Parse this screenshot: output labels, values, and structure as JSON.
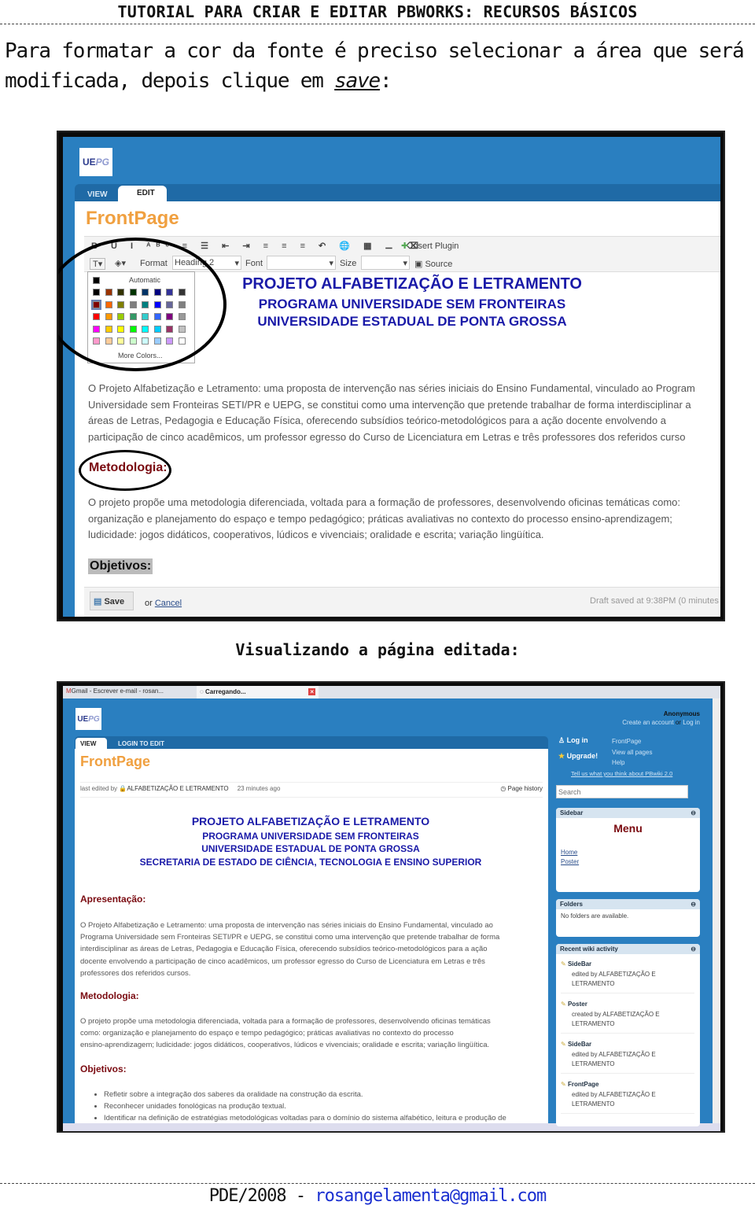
{
  "header": {
    "title": "TUTORIAL PARA CRIAR E EDITAR PBWORKS: RECURSOS BÁSICOS"
  },
  "intro": {
    "line1": "Para formatar a cor da fonte é preciso selecionar a área que será",
    "line2_prefix": "modificada, depois clique em ",
    "line2_link": "save",
    "line2_suffix": ":"
  },
  "shot1": {
    "logo_a": "UE",
    "logo_b": "PG",
    "tabs": [
      "VIEW",
      "EDIT"
    ],
    "page_title": "FrontPage",
    "toolbar": {
      "insert_plugin": "Insert Plugin",
      "format_label": "Format",
      "format_value": "Heading 2",
      "font_label": "Font",
      "size_label": "Size",
      "source": "Source"
    },
    "palette": {
      "automatic": "Automatic",
      "more": "More Colors...",
      "colors": [
        "#000000",
        "#993300",
        "#333300",
        "#003300",
        "#003366",
        "#000080",
        "#333399",
        "#333333",
        "#800000",
        "#ff6600",
        "#808000",
        "#808080",
        "#008080",
        "#0000ff",
        "#666699",
        "#808080",
        "#ff0000",
        "#ff9900",
        "#99cc00",
        "#339966",
        "#33cccc",
        "#3366ff",
        "#800080",
        "#999999",
        "#ff00ff",
        "#ffcc00",
        "#ffff00",
        "#00ff00",
        "#00ffff",
        "#00ccff",
        "#993366",
        "#c0c0c0",
        "#ff99cc",
        "#ffcc99",
        "#ffff99",
        "#ccffcc",
        "#ccffff",
        "#99ccff",
        "#cc99ff",
        "#ffffff"
      ]
    },
    "headings": [
      "PROJETO ALFABETIZAÇÃO E LETRAMENTO",
      "PROGRAMA UNIVERSIDADE SEM FRONTEIRAS",
      "UNIVERSIDADE ESTADUAL DE PONTA GROSSA"
    ],
    "para1": [
      "O Projeto Alfabetização e Letramento: uma proposta de intervenção nas séries iniciais do Ensino Fundamental, vinculado ao Program",
      "Universidade sem Fronteiras SETI/PR e UEPG, se constitui como uma intervenção que pretende trabalhar de forma interdisciplinar a",
      "áreas de Letras, Pedagogia e Educação Física, oferecendo subsídios teórico-metodológicos para a ação docente envolvendo a",
      "participação de cinco acadêmicos, um professor egresso do Curso de Licenciatura em Letras e três professores dos referidos curso"
    ],
    "metodologia": "Metodologia:",
    "para2": [
      "O projeto propõe uma metodologia diferenciada, voltada para a formação de professores, desenvolvendo oficinas temáticas como:",
      "organização e planejamento do espaço e tempo pedagógico; práticas avaliativas no contexto do processo ensino-aprendizagem;",
      "ludicidade: jogos didáticos, cooperativos, lúdicos e vivenciais; oralidade e escrita; variação lingüítica."
    ],
    "objetivos": "Objetivos:",
    "save": "Save",
    "or": "or",
    "cancel": "Cancel",
    "draft": "Draft saved at 9:38PM (0 minutes"
  },
  "caption": "Visualizando a página editada:",
  "shot2": {
    "browser_tabs": [
      "Gmail - Escrever e-mail - rosan...",
      "Carregando..."
    ],
    "logo_a": "UE",
    "logo_b": "PG",
    "user": "Anonymous",
    "create": "Create an account",
    "or": "or",
    "login": "Log in",
    "tabs": [
      "VIEW",
      "LOGIN TO EDIT"
    ],
    "page_title": "FrontPage",
    "edited_prefix": "last edited by",
    "edited_by": "ALFABETIZAÇÃO E LETRAMENTO",
    "edited_when": "23 minutes ago",
    "history": "Page history",
    "headings": [
      "PROJETO ALFABETIZAÇÃO E LETRAMENTO",
      "PROGRAMA UNIVERSIDADE SEM FRONTEIRAS",
      "UNIVERSIDADE ESTADUAL DE PONTA GROSSA",
      "SECRETARIA DE ESTADO DE CIÊNCIA, TECNOLOGIA E ENSINO SUPERIOR"
    ],
    "apresentacao": "Apresentação:",
    "para1": [
      "O Projeto Alfabetização e Letramento: uma proposta de intervenção nas séries iniciais do Ensino Fundamental, vinculado ao",
      "Programa Universidade sem Fronteiras SETI/PR e UEPG, se constitui como uma intervenção que pretende trabalhar de forma",
      "interdisciplinar as áreas de Letras, Pedagogia e Educação Física, oferecendo subsídios teórico-metodológicos para a ação",
      "docente envolvendo a participação de cinco acadêmicos, um professor egresso do Curso de Licenciatura em Letras e três",
      "professores dos referidos cursos."
    ],
    "metodologia": "Metodologia:",
    "para2": [
      "O projeto propõe uma metodologia diferenciada, voltada para a formação de professores, desenvolvendo oficinas temáticas",
      "como: organização e planejamento do espaço e tempo pedagógico; práticas avaliativas no contexto do processo",
      "ensino-aprendizagem; ludicidade: jogos didáticos, cooperativos, lúdicos e vivenciais; oralidade e escrita; variação lingüítica."
    ],
    "objetivos": "Objetivos:",
    "bullets": [
      "Refletir  sobre a integração dos saberes da oralidade na construção da escrita.",
      "Reconhecer unidades fonológicas na produção textual.",
      "Identificar na definição de estratégias metodológicas voltadas para o domínio do sistema alfabético, leitura e produção de"
    ],
    "side": {
      "login": "Log in",
      "upgrade": "Upgrade!",
      "links": [
        "FrontPage",
        "View all pages",
        "Help"
      ],
      "feedback": "Tell us what you think about PBwiki 2.0",
      "search_placeholder": "Search",
      "sidebar_title": "Sidebar",
      "menu": "Menu",
      "menu_links": [
        "Home",
        "Poster"
      ],
      "folders_title": "Folders",
      "folders_text": "No folders are available.",
      "recent_title": "Recent wiki activity",
      "recent": [
        {
          "page": "SideBar",
          "action": "edited by",
          "who": "ALFABETIZAÇÃO E",
          "who2": "LETRAMENTO"
        },
        {
          "page": "Poster",
          "action": "created by",
          "who": "ALFABETIZAÇÃO E",
          "who2": "LETRAMENTO"
        },
        {
          "page": "SideBar",
          "action": "edited by",
          "who": "ALFABETIZAÇÃO E",
          "who2": "LETRAMENTO"
        },
        {
          "page": "FrontPage",
          "action": "edited by",
          "who": "ALFABETIZAÇÃO E",
          "who2": "LETRAMENTO"
        }
      ]
    }
  },
  "footer": {
    "prefix": "PDE/2008 - ",
    "email": "rosangelamenta@gmail.com"
  }
}
